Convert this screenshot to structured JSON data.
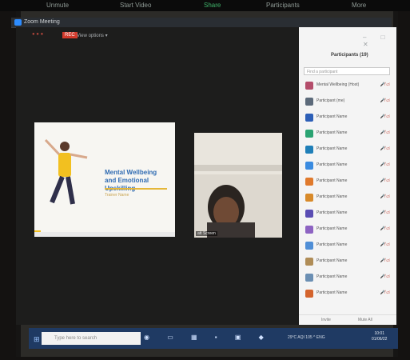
{
  "window": {
    "title": "Zoom Meeting"
  },
  "top_controls": {
    "rec": "REC",
    "view_options": "View options ▾"
  },
  "participants_panel": {
    "title": "Participants (19)",
    "search_placeholder": "Find a participant",
    "footer_left": "Invite",
    "footer_right": "Mute All",
    "rows": [
      {
        "name": "Mental Wellbeing (Host)",
        "color": "#b44d6b"
      },
      {
        "name": "Participant (me)",
        "color": "#5c6a7a"
      },
      {
        "name": "Participant Name",
        "color": "#2d5fb7"
      },
      {
        "name": "Participant Name",
        "color": "#2aa372"
      },
      {
        "name": "Participant Name",
        "color": "#1f7fb8"
      },
      {
        "name": "Participant Name",
        "color": "#3a8be0"
      },
      {
        "name": "Participant Name",
        "color": "#e07a2c"
      },
      {
        "name": "Participant Name",
        "color": "#d88a2a"
      },
      {
        "name": "Participant Name",
        "color": "#5a4db3"
      },
      {
        "name": "Participant Name",
        "color": "#8d63c2"
      },
      {
        "name": "Participant Name",
        "color": "#4f8ed6"
      },
      {
        "name": "Participant Name",
        "color": "#b08d57"
      },
      {
        "name": "Participant Name",
        "color": "#6b8fb3"
      },
      {
        "name": "Participant Name",
        "color": "#d4642d"
      }
    ]
  },
  "slide": {
    "title": "Mental Wellbeing and Emotional Upskilling",
    "subtitle": "Trainer Name"
  },
  "video_tile": {
    "name_label": "att Screen"
  },
  "taskbar": {
    "search_placeholder": "Type here to search",
    "tray_text": "29°C AQI 105 ^ ENG",
    "time": "10:01",
    "date": "01/06/22"
  }
}
